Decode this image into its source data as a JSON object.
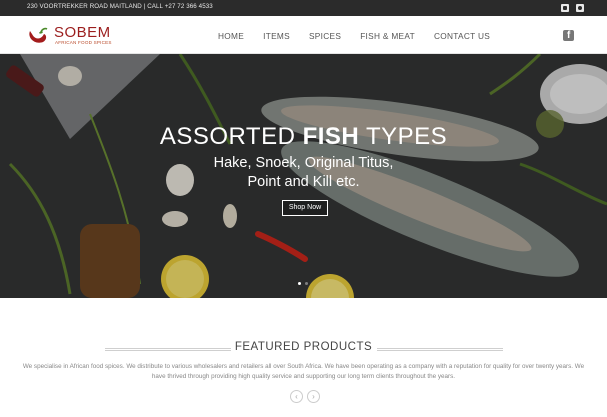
{
  "topbar": {
    "address": "230 VOORTREKKER ROAD MAITLAND | CALL +27 72 366 4533",
    "icons": [
      "twitter-icon",
      "instagram-icon"
    ]
  },
  "logo": {
    "name": "SOBEM",
    "tagline": "AFRICAN FOOD SPICES"
  },
  "nav": {
    "items": [
      "HOME",
      "ITEMS",
      "SPICES",
      "FISH & MEAT",
      "CONTACT US"
    ]
  },
  "header": {
    "social_icon": "facebook-icon"
  },
  "hero": {
    "title_prefix": "ASSORTED ",
    "title_bold": "FISH",
    "title_suffix": " TYPES",
    "subtitle_line1": "Hake, Snoek, Original Titus,",
    "subtitle_line2": "Point and Kill etc.",
    "button_label": "Shop Now",
    "slide_count": 2,
    "active_slide": 1
  },
  "featured": {
    "title": "FEATURED PRODUCTS",
    "description": "We specialise in African food spices. We distribute to various wholesalers and retailers all over South Africa. We have been operating as a company with a reputation for quality for over twenty years. We have thrived through providing high quality service and supporting our long term clients throughout the years.",
    "prev_label": "‹",
    "next_label": "›"
  },
  "colors": {
    "brand_red": "#9b1d1d",
    "topbar_bg": "#2b2b2b",
    "hero_bg": "#2a2c2d"
  }
}
